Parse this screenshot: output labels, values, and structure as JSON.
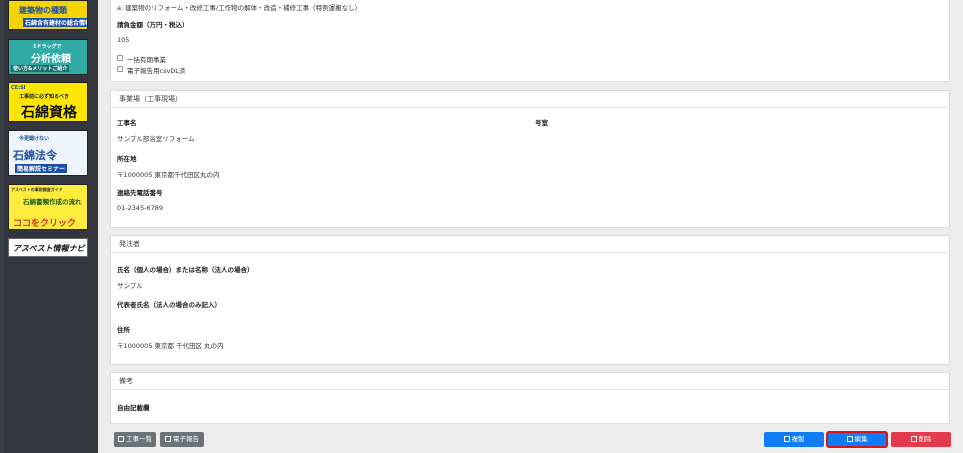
{
  "sidebar": {
    "banners": [
      {
        "title": "建築物の種類",
        "subtitle": "石綿含有建材の総合情報"
      },
      {
        "title": "1ドラッグで",
        "subtitle": "分析依頼",
        "note": "使い方&メリットご紹介"
      },
      {
        "brand": "CE:SI",
        "title": "工事前に必ず知るべき",
        "subtitle": "石綿資格"
      },
      {
        "title": "今更聞けない",
        "subtitle": "石綿法令",
        "note": "簡易解説セミナー"
      },
      {
        "title": "アスベストの事前調査ガイド",
        "subtitle": "石綿書類作成の流れ",
        "cta": "ココをクリック"
      },
      {
        "title": "アスベスト情報ナビ"
      }
    ]
  },
  "top_panel": {
    "work_type_value": "a. 建築物のリフォーム・改修工事/工作物の解体・改造・補修工事（特例運搬なし）",
    "amount_label": "請負金額（万円・税込）",
    "amount_value": "105",
    "check_bulk": "一括有期事業",
    "check_csv": "電子報告用csvDL済"
  },
  "site_panel": {
    "header": "事業場（工事現場）",
    "name_label": "工事名",
    "name_value": "サンプル部浴室リフォーム",
    "room_label": "号室",
    "address_label": "所在地",
    "address_value": "〒1000005 東京都千代田区丸の内",
    "phone_label": "連絡先電話番号",
    "phone_value": "01-2345-6789"
  },
  "client_panel": {
    "header": "発注者",
    "name_label": "氏名（個人の場合）または名称（法人の場合）",
    "name_value": "サンプル",
    "rep_label": "代表者氏名（法人の場合のみ記入）",
    "address_label": "住所",
    "address_value": "〒1000005 東京都 千代田区 丸の内"
  },
  "notes_panel": {
    "header": "備考",
    "free_label": "自由記載欄"
  },
  "footer": {
    "list_button": "工事一覧",
    "report_button": "電子報告",
    "copy_button": "複製",
    "edit_button": "編集",
    "delete_button": "削除"
  },
  "colors": {
    "sidebar": "#33373d",
    "primary": "#0f7cf5",
    "danger": "#e33a4d",
    "secondary": "#6b7379",
    "selected_outline": "#d8141d"
  }
}
